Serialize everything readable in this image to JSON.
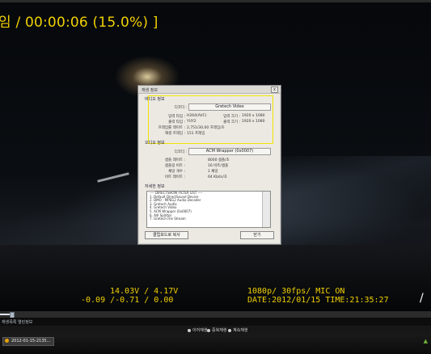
{
  "video": {
    "timecode": "임 / 00:00:06 (15.0%) ]",
    "osd": {
      "voltage_line": "14.03V / 4.17V",
      "gsensor_line": "-0.09 /-0.71 / 0.00",
      "format_line": "1080p/ 30fps/ MIC ON",
      "date_line": "DATE:2012/01/15 TIME:21:35:27"
    }
  },
  "dialog": {
    "title": "재생 정보",
    "close_glyph": "x",
    "video_section": {
      "heading": "비디오 정보",
      "codec_label": "디코더 :",
      "codec_value": "Gretech Video",
      "input_type_label": "입력 타입 :",
      "input_type_value": "H264(AVC)",
      "output_type_label": "출력 타입 :",
      "output_type_value": "YUY2",
      "input_size_label": "입력 크기 :",
      "input_size_value": "1920 x 1080",
      "output_size_label": "출력 크기 :",
      "output_size_value": "1920 x 1080",
      "framerate_label": "프레임률 레이트 :",
      "framerate_value": "2,751/30,00 프레임/초",
      "total_frames_label": "재생 프레임 :",
      "total_frames_value": "151 프레임"
    },
    "audio_section": {
      "heading": "오디오 정보",
      "codec_label": "디코더 :",
      "codec_value": "ACM Wrapper (0x0007)",
      "samplerate_label": "샘플 레이트 :",
      "samplerate_value": "8000 샘플/초",
      "bits_label": "샘플링 비트 :",
      "bits_value": "16 비트/샘플",
      "channels_label": "채널 개수 :",
      "channels_value": "1 채널",
      "bitrate_label": "비트 레이트 :",
      "bitrate_value": "64 Kbits/초"
    },
    "details_section": {
      "heading": "자세한 정보",
      "lines": [
        "---- DIRECTSHOW FILTER LIST ----",
        "1. Default DirectSound Device",
        "2. DMO - MPEG2 Audio Decoder",
        "3. Gretech Audio",
        "4. Gretech Video",
        "5. ACM Wrapper (0x0007)",
        "6. AVI Splitter",
        "7. Gretech File Stream"
      ]
    },
    "copy_button": "클립보드로 복사",
    "close_button": "닫기"
  },
  "player": {
    "progress_percent": 15.0,
    "playlist_title": "재생목록 열린정보",
    "options": [
      "이어재생",
      "중복재생",
      "계속재생"
    ]
  },
  "taskbar": {
    "task_label": "2012-01-15-2135..."
  }
}
